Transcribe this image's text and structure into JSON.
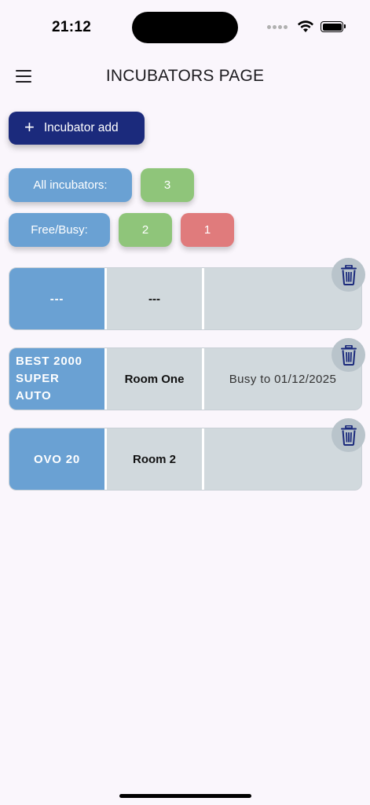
{
  "status_bar": {
    "time": "21:12"
  },
  "app_bar": {
    "title": "INCUBATORS PAGE"
  },
  "actions": {
    "add_label": "Incubator add",
    "add_icon": "+"
  },
  "summary": {
    "all_label": "All incubators:",
    "all_count": "3",
    "free_busy_label": "Free/Busy:",
    "free_count": "2",
    "busy_count": "1"
  },
  "incubators": [
    {
      "name": "---",
      "room": "---",
      "status": ""
    },
    {
      "name": "BEST 2000 SUPER AUTO",
      "room": "Room One",
      "status": "Busy to 01/12/2025"
    },
    {
      "name": "OVO 20",
      "room": "Room 2",
      "status": ""
    }
  ],
  "colors": {
    "primary": "#1b2a7c",
    "chip_blue": "#6aa1d3",
    "chip_green": "#8fc57a",
    "chip_red": "#e07b7c",
    "row_bg": "#d1d9dd"
  },
  "icons": {
    "menu": "menu-icon",
    "trash": "trash-icon",
    "wifi": "wifi-icon",
    "battery": "battery-icon"
  }
}
